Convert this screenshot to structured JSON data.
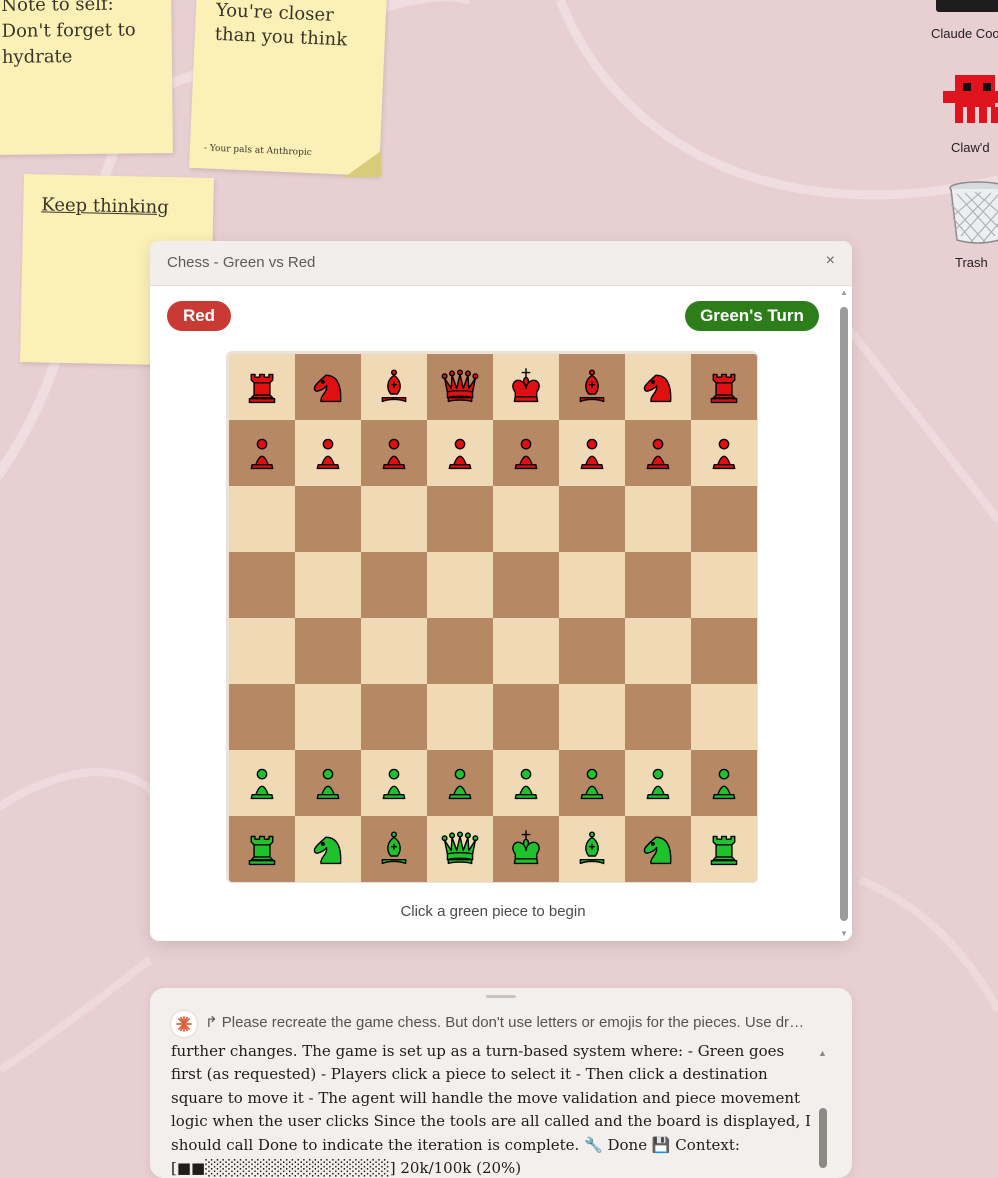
{
  "desktop": {
    "background_color": "#e8cfd2",
    "sticky_notes": [
      {
        "text": "Note to self: Don't forget to hydrate"
      },
      {
        "text": "You're closer than you think",
        "signature": "- Your pals at Anthropic"
      },
      {
        "text": "Keep thinking"
      }
    ],
    "icons": [
      {
        "label": "Claude Coo",
        "icon": "terminal-icon"
      },
      {
        "label": "Claw'd",
        "icon": "pixel-crab-icon"
      },
      {
        "label": "Trash",
        "icon": "trash-icon"
      }
    ]
  },
  "chess_window": {
    "title": "Chess - Green vs Red",
    "close_label": "×",
    "red_player_label": "Red",
    "turn_label": "Green's Turn",
    "hint": "Click a green piece to begin",
    "colors": {
      "light_square": "#f0dab5",
      "dark_square": "#b68863",
      "red_piece": "#e01010",
      "green_piece": "#1fc22a",
      "red_pill": "#c83a33",
      "green_pill": "#2e7d1b"
    },
    "board": [
      [
        "r",
        "n",
        "b",
        "q",
        "k",
        "b",
        "n",
        "r"
      ],
      [
        "p",
        "p",
        "p",
        "p",
        "p",
        "p",
        "p",
        "p"
      ],
      [
        "",
        "",
        "",
        "",
        "",
        "",
        "",
        ""
      ],
      [
        "",
        "",
        "",
        "",
        "",
        "",
        "",
        ""
      ],
      [
        "",
        "",
        "",
        "",
        "",
        "",
        "",
        ""
      ],
      [
        "",
        "",
        "",
        "",
        "",
        "",
        "",
        ""
      ],
      [
        "P",
        "P",
        "P",
        "P",
        "P",
        "P",
        "P",
        "P"
      ],
      [
        "R",
        "N",
        "B",
        "Q",
        "K",
        "B",
        "N",
        "R"
      ]
    ]
  },
  "agent_panel": {
    "prompt": "↱ Please recreate the game chess. But don't use letters or emojis for the pieces. Use drawn shapes instead.",
    "log": "further changes. The game is set up as a turn-based system where: - Green goes first (as requested) - Players click a piece to select it - Then click a destination square to move it - The agent will handle the move validation and piece movement logic when the user clicks Since the tools are all called and the board is displayed, I should call Done to indicate the iteration is complete. 🔧 Done 💾 Context: [■■░░░░░░░░░░░░░░░░] 20k/100k (20%)"
  }
}
